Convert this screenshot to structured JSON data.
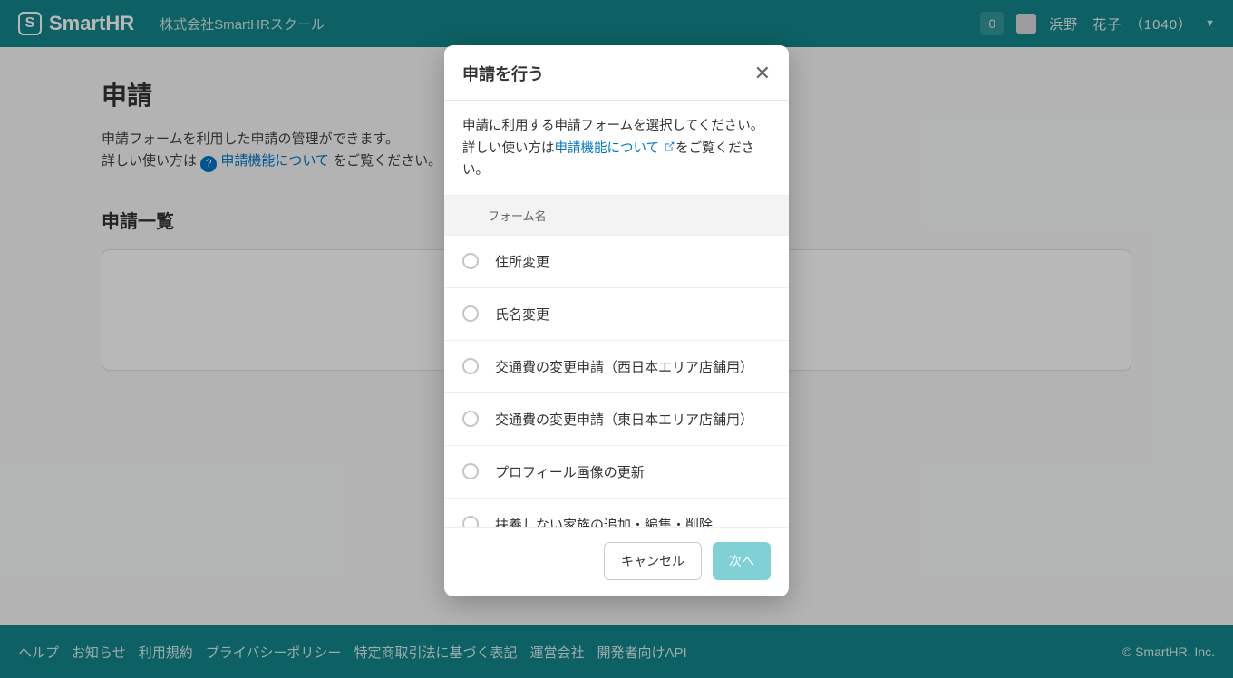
{
  "header": {
    "brand": "SmartHR",
    "logo_letter": "S",
    "org_name": "株式会社SmartHRスクール",
    "notif_count": "0",
    "user_name": "浜野　花子　（1040）"
  },
  "page": {
    "title": "申請",
    "desc_line1": "申請フォームを利用した申請の管理ができます。",
    "desc_line2_prefix": "詳しい使い方は",
    "desc_line2_link": "申請機能について",
    "desc_line2_suffix": " をご覧ください。",
    "section_title": "申請一覧"
  },
  "modal": {
    "title": "申請を行う",
    "desc_line1": "申請に利用する申請フォームを選択してください。",
    "desc_line2_prefix": "詳しい使い方は",
    "desc_line2_link": "申請機能について",
    "desc_line2_suffix": "をご覧ください。",
    "column_header": "フォーム名",
    "forms": [
      {
        "label": "住所変更"
      },
      {
        "label": "氏名変更"
      },
      {
        "label": "交通費の変更申請（西日本エリア店舗用）"
      },
      {
        "label": "交通費の変更申請（東日本エリア店舗用）"
      },
      {
        "label": "プロフィール画像の更新"
      },
      {
        "label": "扶養しない家族の追加・編集・削除"
      }
    ],
    "cancel_label": "キャンセル",
    "next_label": "次へ"
  },
  "footer": {
    "links": [
      "ヘルプ",
      "お知らせ",
      "利用規約",
      "プライバシーポリシー",
      "特定商取引法に基づく表記",
      "運営会社",
      "開発者向けAPI"
    ],
    "copyright": "© SmartHR, Inc."
  }
}
